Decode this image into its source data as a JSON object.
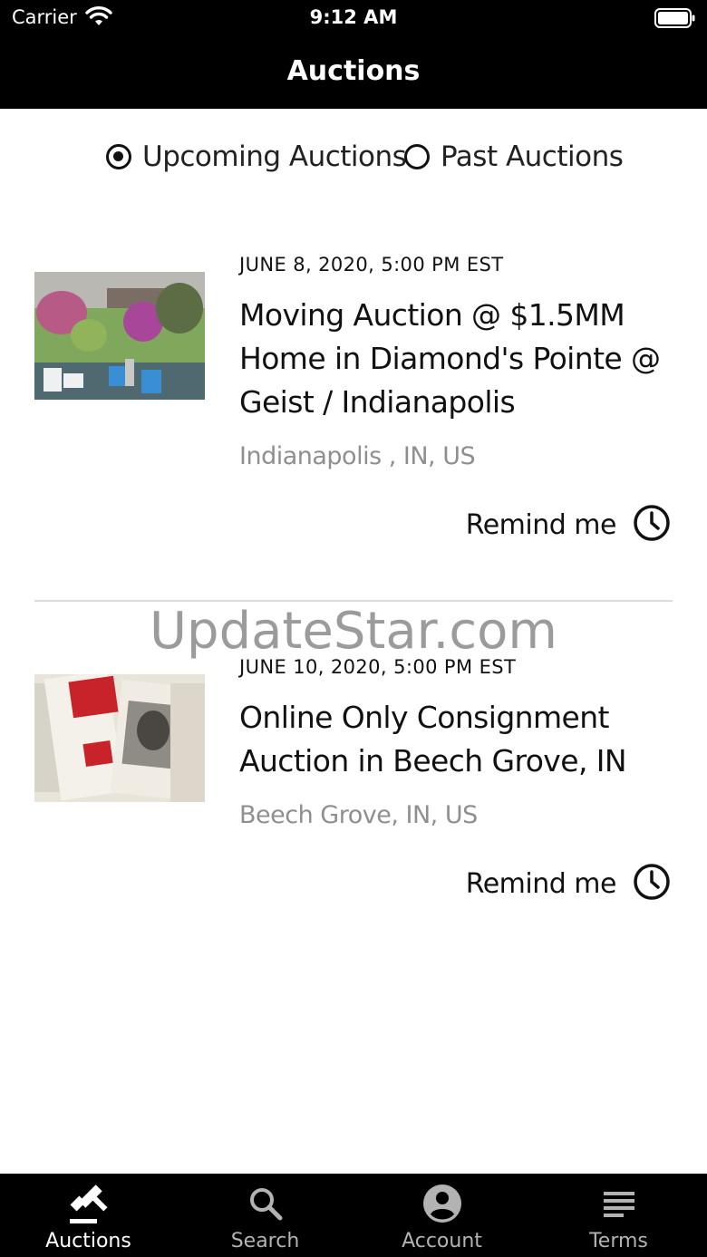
{
  "status_bar": {
    "carrier": "Carrier",
    "time": "9:12 AM"
  },
  "nav": {
    "title": "Auctions"
  },
  "filter": {
    "options": [
      {
        "label": "Upcoming Auctions",
        "selected": true
      },
      {
        "label": "Past Auctions",
        "selected": false
      }
    ]
  },
  "auctions": [
    {
      "date": "JUNE 8, 2020, 5:00 PM EST",
      "title": "Moving Auction @ $1.5MM Home in Diamond's Pointe @ Geist / Indianapolis",
      "location": "Indianapolis , IN, US",
      "remind_label": "Remind me"
    },
    {
      "date": "JUNE 10, 2020, 5:00 PM EST",
      "title": "Online Only Consignment Auction in Beech Grove, IN",
      "location": "Beech Grove, IN, US",
      "remind_label": "Remind me"
    }
  ],
  "watermark": "UpdateStar.com",
  "tabs": [
    {
      "label": "Auctions",
      "icon": "gavel-icon",
      "active": true
    },
    {
      "label": "Search",
      "icon": "search-icon",
      "active": false
    },
    {
      "label": "Account",
      "icon": "account-icon",
      "active": false
    },
    {
      "label": "Terms",
      "icon": "terms-icon",
      "active": false
    }
  ],
  "colors": {
    "bar": "#000000",
    "tab_active": "#ffffff",
    "tab_inactive": "#b3b3b3",
    "location": "#8f8f8f"
  }
}
